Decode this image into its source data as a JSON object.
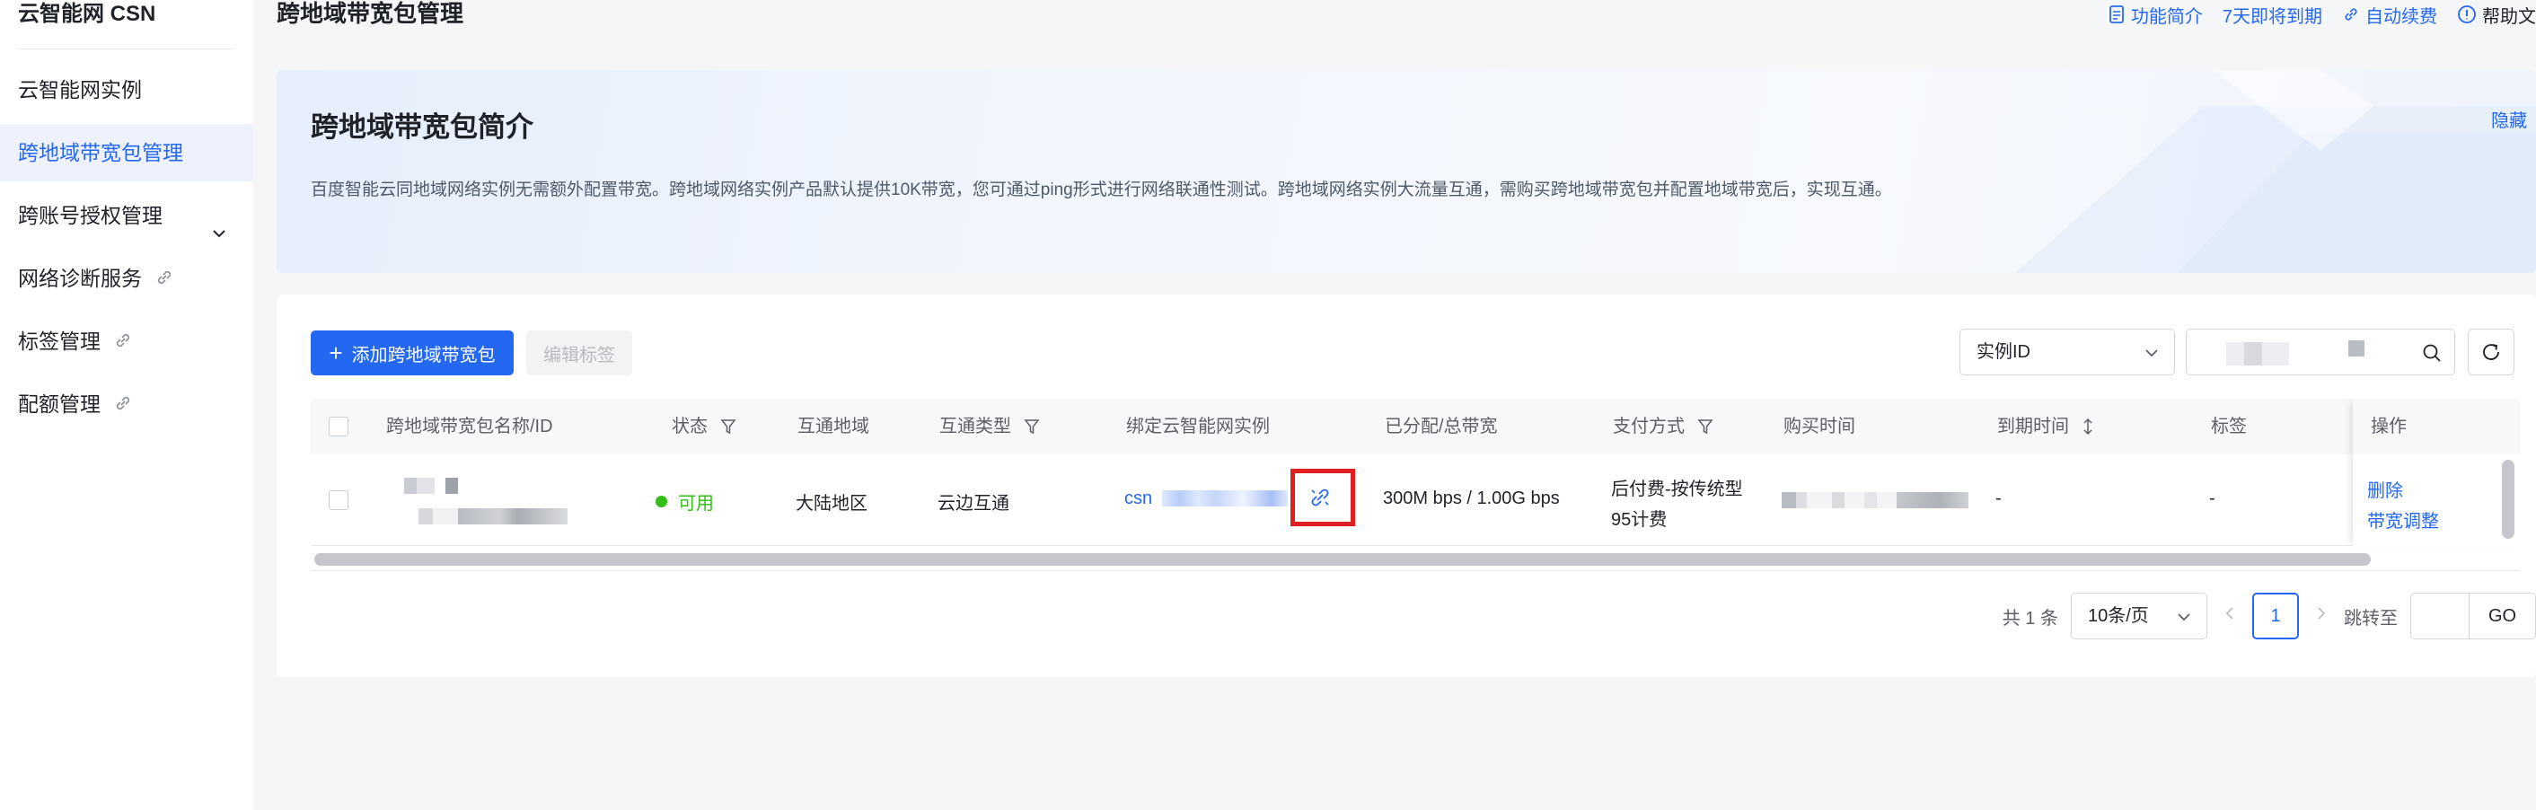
{
  "sidebar": {
    "title": "云智能网 CSN",
    "items": [
      {
        "label": "云智能网实例"
      },
      {
        "label": "跨地域带宽包管理"
      },
      {
        "label": "跨账号授权管理"
      },
      {
        "label": "网络诊断服务"
      },
      {
        "label": "标签管理"
      },
      {
        "label": "配额管理"
      }
    ]
  },
  "header": {
    "title": "跨地域带宽包管理",
    "links": {
      "intro": "功能简介",
      "expire": "7天即将到期",
      "renew": "自动续费",
      "help": "帮助文"
    }
  },
  "intro": {
    "title": "跨地域带宽包简介",
    "hide": "隐藏",
    "description": "百度智能云同地域网络实例无需额外配置带宽。跨地域网络实例产品默认提供10K带宽，您可通过ping形式进行网络联通性测试。跨地域网络实例大流量互通，需购买跨地域带宽包并配置地域带宽后，实现互通。"
  },
  "toolbar": {
    "add_label": "添加跨地域带宽包",
    "edit_tags_label": "编辑标签",
    "select_value": "实例ID"
  },
  "table": {
    "columns": {
      "name": "跨地域带宽包名称/ID",
      "status": "状态",
      "region": "互通地域",
      "type": "互通类型",
      "bound": "绑定云智能网实例",
      "bandwidth": "已分配/总带宽",
      "payment": "支付方式",
      "purchase": "购买时间",
      "expire": "到期时间",
      "tags": "标签",
      "ops": "操作"
    },
    "rows": [
      {
        "status": "可用",
        "region": "大陆地区",
        "type": "云边互通",
        "bound_prefix": "csn",
        "bandwidth": "300M bps / 1.00G bps",
        "payment_line1": "后付费-按传统型",
        "payment_line2": "95计费",
        "expire": "-",
        "tags": "-",
        "op_delete": "删除",
        "op_adjust": "带宽调整"
      }
    ]
  },
  "pagination": {
    "total": "共 1 条",
    "page_size": "10条/页",
    "current_page": "1",
    "jump_label": "跳转至",
    "go": "GO"
  },
  "colors": {
    "primary": "#2468f2",
    "status_ok": "#30bf13",
    "highlight": "#e02020"
  }
}
